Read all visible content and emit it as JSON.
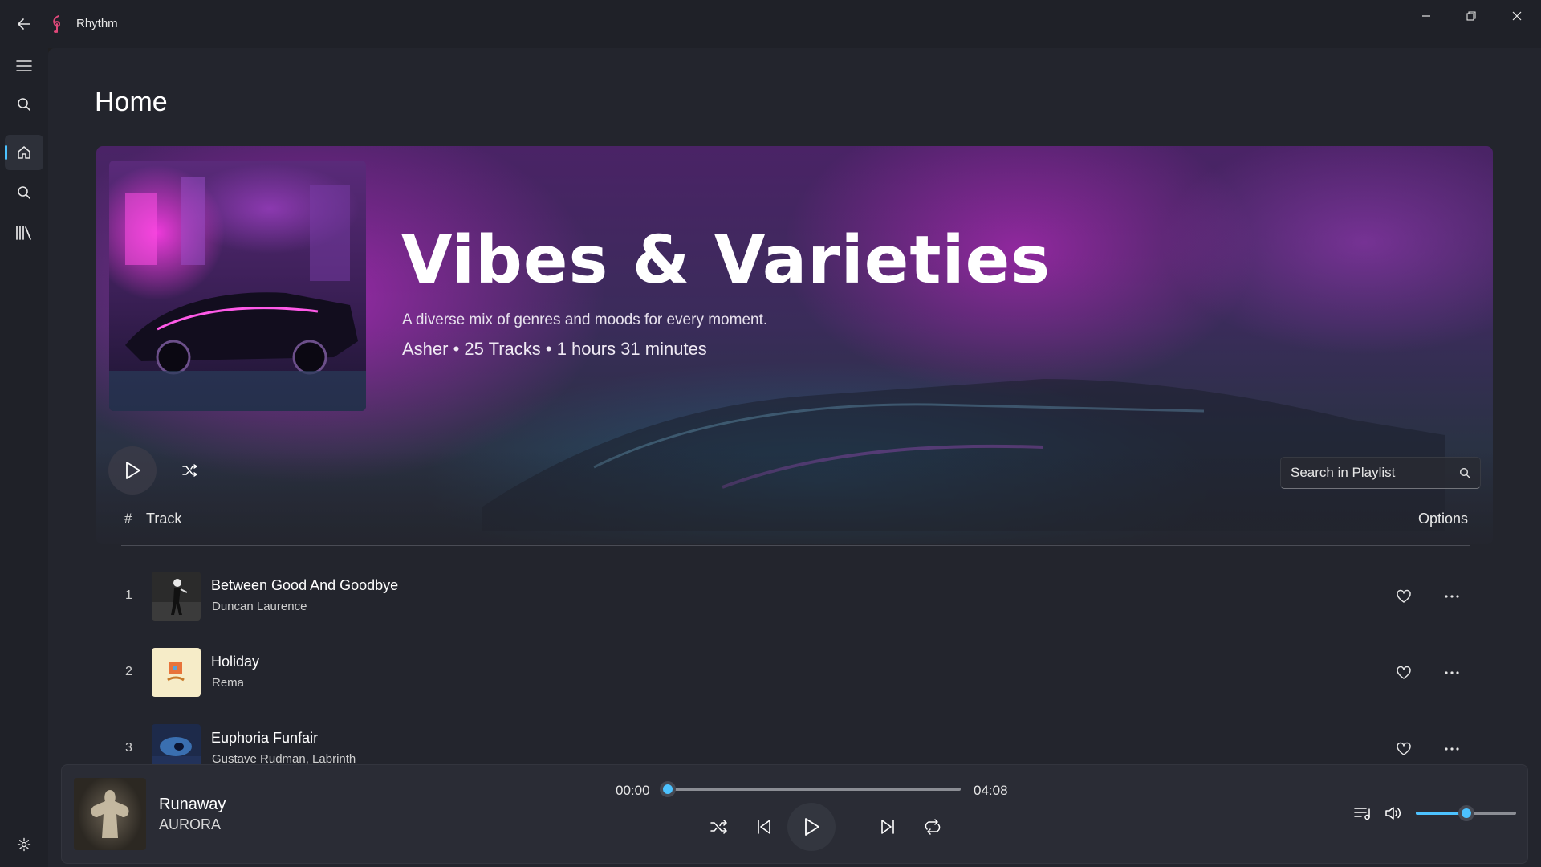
{
  "app": {
    "title": "Rhythm",
    "accent": "#4cc2ff",
    "logo_color": "#e0487a"
  },
  "window_controls": [
    "minimize-icon",
    "restore-icon",
    "close-icon"
  ],
  "nav": {
    "items": [
      {
        "name": "menu",
        "icon": "hamburger-icon"
      },
      {
        "name": "search",
        "icon": "search-icon"
      },
      {
        "name": "home",
        "icon": "home-icon",
        "active": true
      },
      {
        "name": "explore",
        "icon": "search-icon"
      },
      {
        "name": "library",
        "icon": "library-icon"
      }
    ],
    "footer": {
      "name": "settings",
      "icon": "gear-icon"
    }
  },
  "page": {
    "title": "Home"
  },
  "playlist": {
    "title": "Vibes & Varieties",
    "description": "A diverse mix of genres and moods for every moment.",
    "meta": "Asher • 25 Tracks • 1 hours 31 minutes",
    "search_placeholder": "Search in Playlist",
    "header": {
      "hash": "#",
      "track": "Track",
      "options": "Options"
    },
    "tracks": [
      {
        "num": "1",
        "title": "Between Good And Goodbye",
        "artist": "Duncan Laurence"
      },
      {
        "num": "2",
        "title": "Holiday",
        "artist": "Rema"
      },
      {
        "num": "3",
        "title": "Euphoria Funfair",
        "artist": "Gustave Rudman, Labrinth"
      }
    ]
  },
  "player": {
    "now_playing": {
      "title": "Runaway",
      "artist": "AURORA"
    },
    "time_current": "00:00",
    "time_total": "04:08",
    "progress": 0.0,
    "volume": 0.5
  }
}
